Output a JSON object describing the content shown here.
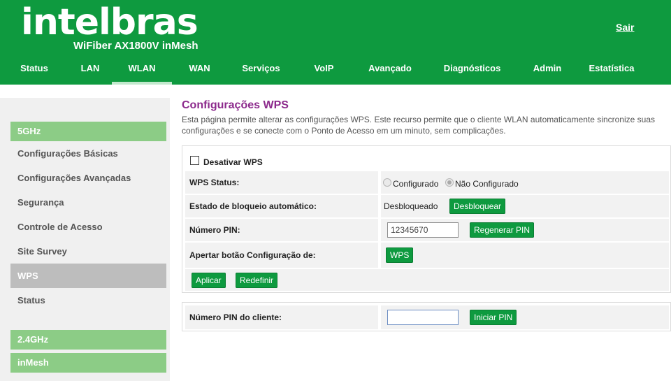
{
  "header": {
    "brand": "intelbras",
    "model": "WiFiber AX1800V inMesh",
    "logout": "Sair"
  },
  "nav": {
    "items": [
      {
        "label": "Status"
      },
      {
        "label": "LAN"
      },
      {
        "label": "WLAN",
        "active": true
      },
      {
        "label": "WAN"
      },
      {
        "label": "Serviços"
      },
      {
        "label": "VoIP"
      },
      {
        "label": "Avançado"
      },
      {
        "label": "Diagnósticos"
      },
      {
        "label": "Admin"
      },
      {
        "label": "Estatística"
      }
    ]
  },
  "sidebar": {
    "section_5g": "5GHz",
    "items": [
      {
        "label": "Configurações Básicas"
      },
      {
        "label": "Configurações Avançadas"
      },
      {
        "label": "Segurança"
      },
      {
        "label": "Controle de Acesso"
      },
      {
        "label": "Site Survey"
      },
      {
        "label": "WPS",
        "active": true
      },
      {
        "label": "Status"
      }
    ],
    "section_24g": "2.4GHz",
    "section_inmesh": "inMesh"
  },
  "main": {
    "title": "Configurações WPS",
    "description": "Esta página permite alterar as configurações WPS. Este recurso permite que o cliente WLAN automaticamente sincronize suas configurações e se conecte com o Ponto de Acesso em um minuto, sem complicações.",
    "disable_wps_label": "Desativar WPS",
    "wps_status_label": "WPS Status:",
    "status_configured": "Configurado",
    "status_not_configured": "Não Configurado",
    "autolock_label": "Estado de bloqueio automático:",
    "autolock_value": "Desbloqueado",
    "unlock_button": "Desbloquear",
    "pin_label": "Número PIN:",
    "pin_value": "12345670",
    "regen_pin_button": "Regenerar PIN",
    "push_label": "Apertar botão Configuração de:",
    "wps_button": "WPS",
    "apply_button": "Aplicar",
    "reset_button": "Redefinir",
    "client_pin_label": "Número PIN do cliente:",
    "client_pin_value": "",
    "start_pin_button": "Iniciar PIN"
  },
  "colors": {
    "brand_green": "#0e9a3f",
    "sidebar_header": "#8ccc86",
    "title_purple": "#8c2a8c"
  }
}
